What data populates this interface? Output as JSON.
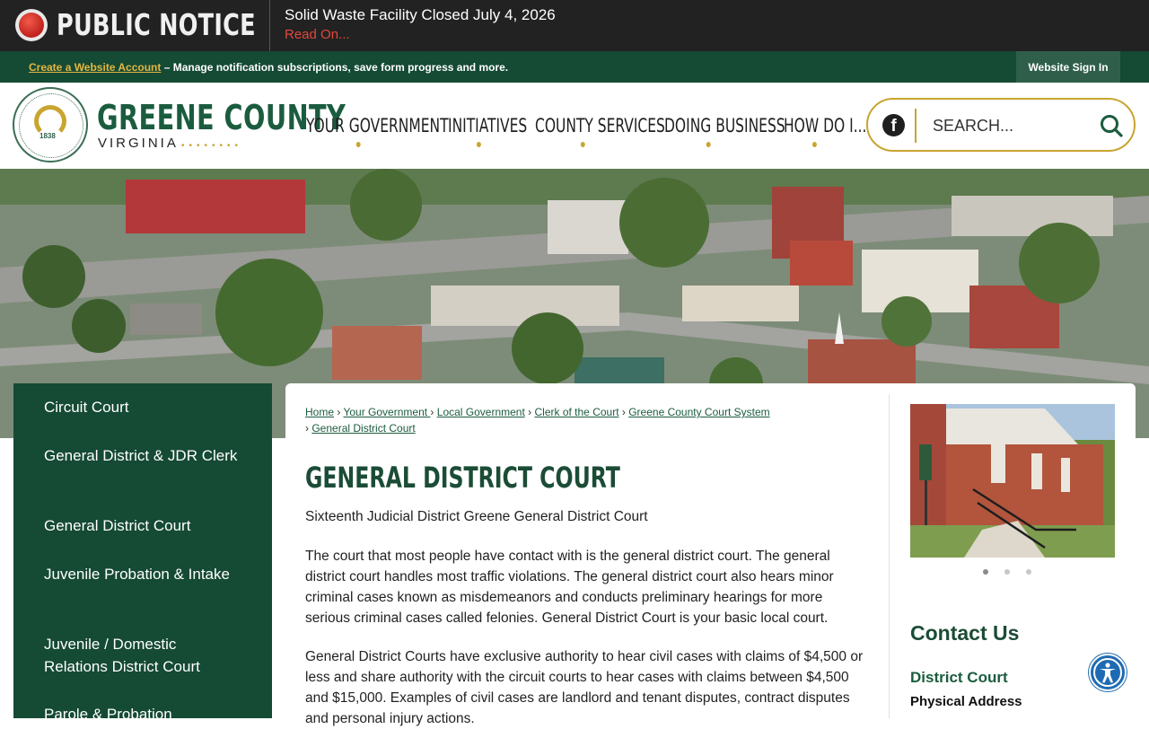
{
  "notice": {
    "label": "PUBLIC NOTICE",
    "title": "Solid Waste Facility Closed July 4, 2026",
    "read_more": "Read On..."
  },
  "account_bar": {
    "create_link": "Create a Website Account",
    "description": " – Manage notification subscriptions, save form progress and more.",
    "sign_in": "Website Sign In"
  },
  "logo": {
    "name": "GREENE COUNTY",
    "state": "VIRGINIA",
    "seal_year": "1838"
  },
  "nav": {
    "items": [
      {
        "label": "YOUR GOVERNMENT"
      },
      {
        "label": "INITIATIVES"
      },
      {
        "label": "COUNTY SERVICES"
      },
      {
        "label": "DOING BUSINESS"
      },
      {
        "label": "HOW DO I..."
      }
    ]
  },
  "search": {
    "placeholder": "SEARCH..."
  },
  "sidebar": {
    "items": [
      {
        "label": "Circuit Court"
      },
      {
        "label": "General District & JDR Clerk"
      },
      {
        "label": "General District Court"
      },
      {
        "label": "Juvenile Probation & Intake"
      },
      {
        "label": "Juvenile / Domestic Relations District Court"
      },
      {
        "label": "Parole & Probation"
      }
    ]
  },
  "breadcrumb": {
    "items": [
      {
        "label": "Home"
      },
      {
        "label": "Your Government "
      },
      {
        "label": "Local Government"
      },
      {
        "label": "Clerk of the Court"
      },
      {
        "label": "Greene County Court System"
      },
      {
        "label": "General District Court"
      }
    ]
  },
  "main": {
    "title": "GENERAL DISTRICT COURT",
    "paragraphs": [
      "Sixteenth Judicial District Greene General District Court",
      "The court that most people have contact with is the general district court. The general district court handles most traffic violations. The general district court also hears minor criminal cases known as misdemeanors and conducts preliminary hearings for more serious criminal cases called felonies. General District Court is your basic local court.",
      "General District Courts have exclusive authority to hear civil cases with claims of $4,500 or less and share authority with the circuit courts to hear cases with claims between $4,500 and $15,000. Examples of civil cases are landlord and tenant disputes, contract disputes and personal injury actions."
    ]
  },
  "contact": {
    "title": "Contact Us",
    "office": "District Court",
    "address_label": "Physical Address"
  },
  "slideshow": {
    "slide_count": 3,
    "active_index": 0
  },
  "colors": {
    "brand_green": "#154a35",
    "accent_gold": "#c9a530",
    "notice_red": "#e0493b",
    "accessibility_blue": "#1f6bb3"
  },
  "icons": {
    "notice": "alert-dot-icon",
    "facebook": "facebook-icon",
    "search": "search-icon",
    "accessibility": "accessibility-icon"
  }
}
